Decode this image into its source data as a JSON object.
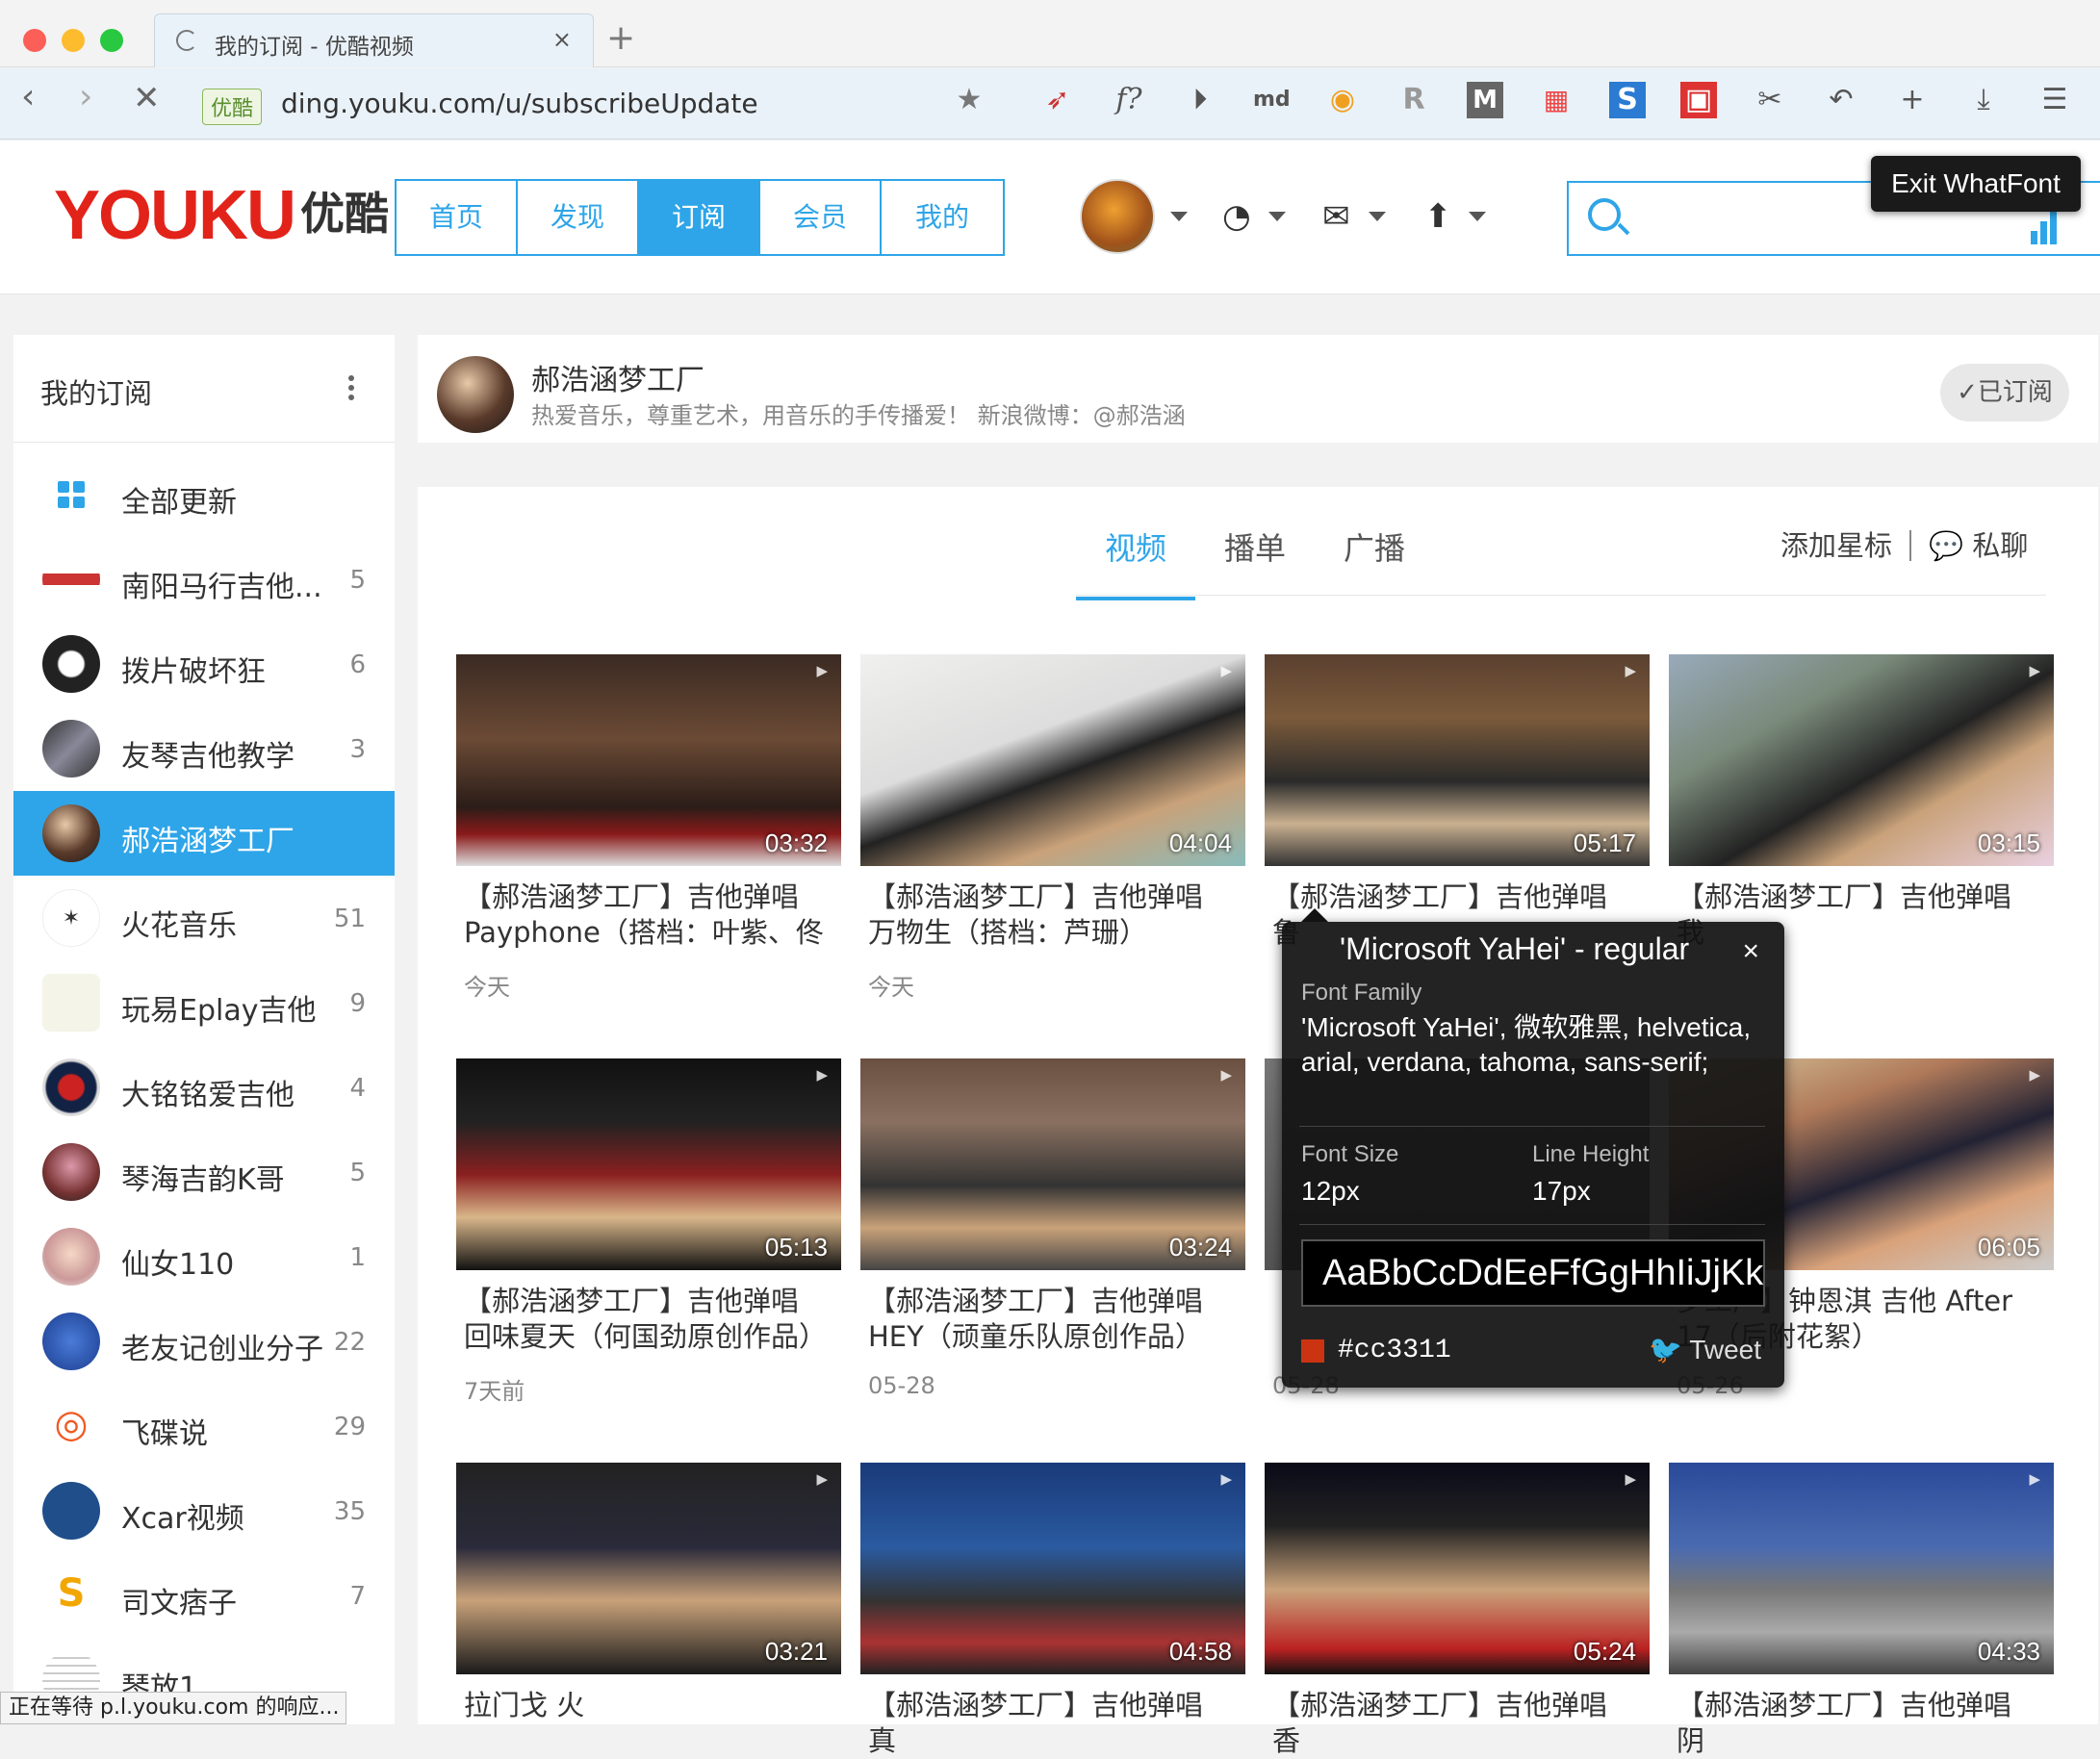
{
  "browser": {
    "tab_title": "我的订阅 - 优酷视频",
    "url_badge": "优酷",
    "url": "ding.youku.com/u/subscribeUpdate",
    "md_label": "md",
    "f_label": "f?"
  },
  "header": {
    "logo_text": "YOUKU",
    "logo_cn": "优酷",
    "nav": [
      {
        "label": "首页"
      },
      {
        "label": "发现"
      },
      {
        "label": "订阅"
      },
      {
        "label": "会员"
      },
      {
        "label": "我的"
      }
    ]
  },
  "overlay_button": "Exit WhatFont",
  "sidebar": {
    "title": "我的订阅",
    "items": [
      {
        "name": "全部更新",
        "count": ""
      },
      {
        "name": "南阳马行吉他...",
        "count": "5"
      },
      {
        "name": "拨片破坏狂",
        "count": "6"
      },
      {
        "name": "友琴吉他教学",
        "count": "3"
      },
      {
        "name": "郝浩涵梦工厂",
        "count": ""
      },
      {
        "name": "火花音乐",
        "count": "51"
      },
      {
        "name": "玩易Eplay吉他",
        "count": "9"
      },
      {
        "name": "大铭铭爱吉他",
        "count": "4"
      },
      {
        "name": "琴海吉韵K哥",
        "count": "5"
      },
      {
        "name": "仙女110",
        "count": "1"
      },
      {
        "name": "老友记创业分子",
        "count": "22"
      },
      {
        "name": "飞碟说",
        "count": "29"
      },
      {
        "name": "Xcar视频",
        "count": "35"
      },
      {
        "name": "司文痞子",
        "count": "7"
      },
      {
        "name": "琴放1",
        "count": ""
      }
    ]
  },
  "channel": {
    "name": "郝浩涵梦工厂",
    "desc": "热爱音乐，尊重艺术，用音乐的手传播爱！ 新浪微博：@郝浩涵",
    "subscribed": "✓已订阅"
  },
  "tabs": [
    {
      "label": "视频"
    },
    {
      "label": "播单"
    },
    {
      "label": "广播"
    }
  ],
  "actions": {
    "star": "添加星标",
    "chat": "私聊"
  },
  "videos": [
    {
      "duration": "03:32",
      "title": "【郝浩涵梦工厂】吉他弹唱 Payphone（搭档：叶紫、佟",
      "date": "今天"
    },
    {
      "duration": "04:04",
      "title": "【郝浩涵梦工厂】吉他弹唱 万物生（搭档：芦珊）",
      "date": "今天"
    },
    {
      "duration": "05:17",
      "title": "【郝浩涵梦工厂】吉他弹唱 鲁",
      "date": ""
    },
    {
      "duration": "03:15",
      "title": "【郝浩涵梦工厂】吉他弹唱 我",
      "date": ""
    },
    {
      "duration": "05:13",
      "title": "【郝浩涵梦工厂】吉他弹唱 回味夏天（何国劲原创作品）",
      "date": "7天前"
    },
    {
      "duration": "03:24",
      "title": "【郝浩涵梦工厂】吉他弹唱 HEY（顽童乐队原创作品）",
      "date": "05-28"
    },
    {
      "duration": "",
      "title": "",
      "date": "05-28"
    },
    {
      "duration": "06:05",
      "title": "梦工厂】钟恩淇 吉他 After 17（后附花絮）",
      "date": "05-26"
    },
    {
      "duration": "03:21",
      "title": "拉门戈 火",
      "date": ""
    },
    {
      "duration": "04:58",
      "title": "【郝浩涵梦工厂】吉他弹唱 真",
      "date": ""
    },
    {
      "duration": "05:24",
      "title": "【郝浩涵梦工厂】吉他弹唱 香",
      "date": ""
    },
    {
      "duration": "04:33",
      "title": "【郝浩涵梦工厂】吉他弹唱 阴",
      "date": ""
    }
  ],
  "whatfont": {
    "title": "'Microsoft YaHei' - regular",
    "family_label": "Font Family",
    "family_value": "'Microsoft YaHei', 微软雅黑, helvetica, arial, verdana, tahoma, sans-serif;",
    "size_label": "Font Size",
    "size_value": "12px",
    "lh_label": "Line Height",
    "lh_value": "17px",
    "sample": "AaBbCcDdEeFfGgHhIiJjKkLl",
    "color_hex": "#cc3311",
    "tweet": "Tweet",
    "close": "×"
  },
  "status_bar": "正在等待 p.l.youku.com 的响应..."
}
